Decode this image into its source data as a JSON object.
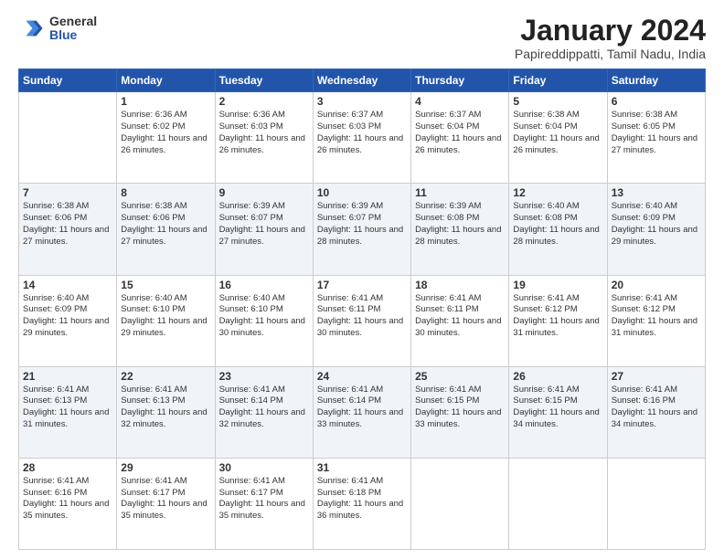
{
  "logo": {
    "general": "General",
    "blue": "Blue"
  },
  "title": "January 2024",
  "location": "Papireddippatti, Tamil Nadu, India",
  "days_header": [
    "Sunday",
    "Monday",
    "Tuesday",
    "Wednesday",
    "Thursday",
    "Friday",
    "Saturday"
  ],
  "weeks": [
    [
      {
        "day": "",
        "sunrise": "",
        "sunset": "",
        "daylight": ""
      },
      {
        "day": "1",
        "sunrise": "Sunrise: 6:36 AM",
        "sunset": "Sunset: 6:02 PM",
        "daylight": "Daylight: 11 hours and 26 minutes."
      },
      {
        "day": "2",
        "sunrise": "Sunrise: 6:36 AM",
        "sunset": "Sunset: 6:03 PM",
        "daylight": "Daylight: 11 hours and 26 minutes."
      },
      {
        "day": "3",
        "sunrise": "Sunrise: 6:37 AM",
        "sunset": "Sunset: 6:03 PM",
        "daylight": "Daylight: 11 hours and 26 minutes."
      },
      {
        "day": "4",
        "sunrise": "Sunrise: 6:37 AM",
        "sunset": "Sunset: 6:04 PM",
        "daylight": "Daylight: 11 hours and 26 minutes."
      },
      {
        "day": "5",
        "sunrise": "Sunrise: 6:38 AM",
        "sunset": "Sunset: 6:04 PM",
        "daylight": "Daylight: 11 hours and 26 minutes."
      },
      {
        "day": "6",
        "sunrise": "Sunrise: 6:38 AM",
        "sunset": "Sunset: 6:05 PM",
        "daylight": "Daylight: 11 hours and 27 minutes."
      }
    ],
    [
      {
        "day": "7",
        "sunrise": "Sunrise: 6:38 AM",
        "sunset": "Sunset: 6:06 PM",
        "daylight": "Daylight: 11 hours and 27 minutes."
      },
      {
        "day": "8",
        "sunrise": "Sunrise: 6:38 AM",
        "sunset": "Sunset: 6:06 PM",
        "daylight": "Daylight: 11 hours and 27 minutes."
      },
      {
        "day": "9",
        "sunrise": "Sunrise: 6:39 AM",
        "sunset": "Sunset: 6:07 PM",
        "daylight": "Daylight: 11 hours and 27 minutes."
      },
      {
        "day": "10",
        "sunrise": "Sunrise: 6:39 AM",
        "sunset": "Sunset: 6:07 PM",
        "daylight": "Daylight: 11 hours and 28 minutes."
      },
      {
        "day": "11",
        "sunrise": "Sunrise: 6:39 AM",
        "sunset": "Sunset: 6:08 PM",
        "daylight": "Daylight: 11 hours and 28 minutes."
      },
      {
        "day": "12",
        "sunrise": "Sunrise: 6:40 AM",
        "sunset": "Sunset: 6:08 PM",
        "daylight": "Daylight: 11 hours and 28 minutes."
      },
      {
        "day": "13",
        "sunrise": "Sunrise: 6:40 AM",
        "sunset": "Sunset: 6:09 PM",
        "daylight": "Daylight: 11 hours and 29 minutes."
      }
    ],
    [
      {
        "day": "14",
        "sunrise": "Sunrise: 6:40 AM",
        "sunset": "Sunset: 6:09 PM",
        "daylight": "Daylight: 11 hours and 29 minutes."
      },
      {
        "day": "15",
        "sunrise": "Sunrise: 6:40 AM",
        "sunset": "Sunset: 6:10 PM",
        "daylight": "Daylight: 11 hours and 29 minutes."
      },
      {
        "day": "16",
        "sunrise": "Sunrise: 6:40 AM",
        "sunset": "Sunset: 6:10 PM",
        "daylight": "Daylight: 11 hours and 30 minutes."
      },
      {
        "day": "17",
        "sunrise": "Sunrise: 6:41 AM",
        "sunset": "Sunset: 6:11 PM",
        "daylight": "Daylight: 11 hours and 30 minutes."
      },
      {
        "day": "18",
        "sunrise": "Sunrise: 6:41 AM",
        "sunset": "Sunset: 6:11 PM",
        "daylight": "Daylight: 11 hours and 30 minutes."
      },
      {
        "day": "19",
        "sunrise": "Sunrise: 6:41 AM",
        "sunset": "Sunset: 6:12 PM",
        "daylight": "Daylight: 11 hours and 31 minutes."
      },
      {
        "day": "20",
        "sunrise": "Sunrise: 6:41 AM",
        "sunset": "Sunset: 6:12 PM",
        "daylight": "Daylight: 11 hours and 31 minutes."
      }
    ],
    [
      {
        "day": "21",
        "sunrise": "Sunrise: 6:41 AM",
        "sunset": "Sunset: 6:13 PM",
        "daylight": "Daylight: 11 hours and 31 minutes."
      },
      {
        "day": "22",
        "sunrise": "Sunrise: 6:41 AM",
        "sunset": "Sunset: 6:13 PM",
        "daylight": "Daylight: 11 hours and 32 minutes."
      },
      {
        "day": "23",
        "sunrise": "Sunrise: 6:41 AM",
        "sunset": "Sunset: 6:14 PM",
        "daylight": "Daylight: 11 hours and 32 minutes."
      },
      {
        "day": "24",
        "sunrise": "Sunrise: 6:41 AM",
        "sunset": "Sunset: 6:14 PM",
        "daylight": "Daylight: 11 hours and 33 minutes."
      },
      {
        "day": "25",
        "sunrise": "Sunrise: 6:41 AM",
        "sunset": "Sunset: 6:15 PM",
        "daylight": "Daylight: 11 hours and 33 minutes."
      },
      {
        "day": "26",
        "sunrise": "Sunrise: 6:41 AM",
        "sunset": "Sunset: 6:15 PM",
        "daylight": "Daylight: 11 hours and 34 minutes."
      },
      {
        "day": "27",
        "sunrise": "Sunrise: 6:41 AM",
        "sunset": "Sunset: 6:16 PM",
        "daylight": "Daylight: 11 hours and 34 minutes."
      }
    ],
    [
      {
        "day": "28",
        "sunrise": "Sunrise: 6:41 AM",
        "sunset": "Sunset: 6:16 PM",
        "daylight": "Daylight: 11 hours and 35 minutes."
      },
      {
        "day": "29",
        "sunrise": "Sunrise: 6:41 AM",
        "sunset": "Sunset: 6:17 PM",
        "daylight": "Daylight: 11 hours and 35 minutes."
      },
      {
        "day": "30",
        "sunrise": "Sunrise: 6:41 AM",
        "sunset": "Sunset: 6:17 PM",
        "daylight": "Daylight: 11 hours and 35 minutes."
      },
      {
        "day": "31",
        "sunrise": "Sunrise: 6:41 AM",
        "sunset": "Sunset: 6:18 PM",
        "daylight": "Daylight: 11 hours and 36 minutes."
      },
      {
        "day": "",
        "sunrise": "",
        "sunset": "",
        "daylight": ""
      },
      {
        "day": "",
        "sunrise": "",
        "sunset": "",
        "daylight": ""
      },
      {
        "day": "",
        "sunrise": "",
        "sunset": "",
        "daylight": ""
      }
    ]
  ]
}
